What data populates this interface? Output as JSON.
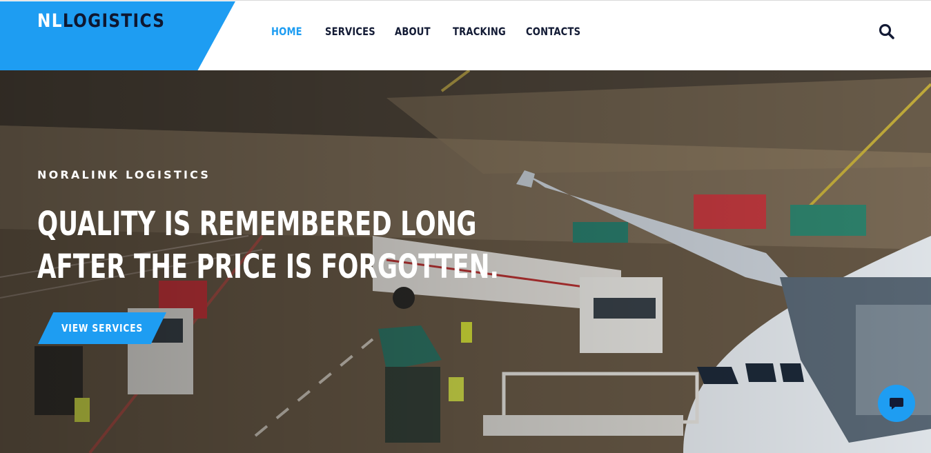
{
  "brand": {
    "logo_prefix": "NL",
    "logo_suffix": "LOGISTICS"
  },
  "nav": {
    "items": [
      {
        "label": "HOME",
        "active": true
      },
      {
        "label": "SERVICES",
        "active": false
      },
      {
        "label": "ABOUT",
        "active": false
      },
      {
        "label": "TRACKING",
        "active": false
      },
      {
        "label": "CONTACTS",
        "active": false
      }
    ],
    "search_icon": "search-icon"
  },
  "hero": {
    "eyebrow": "NORALINK LOGISTICS",
    "headline_line1": "QUALITY IS REMEMBERED LONG",
    "headline_line2": "AFTER THE PRICE IS FORGOTTEN.",
    "cta_label": "VIEW SERVICES",
    "background": "airport-apron-aircraft-photo"
  },
  "chat": {
    "icon": "chat-bubble-icon"
  },
  "colors": {
    "accent": "#1e9df2",
    "dark": "#131b35",
    "white": "#ffffff"
  }
}
